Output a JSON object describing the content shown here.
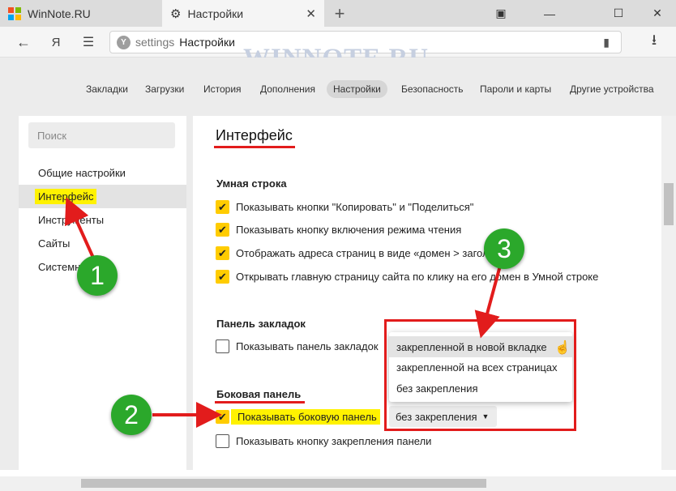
{
  "tabs": [
    {
      "title": "WinNote.RU"
    },
    {
      "title": "Настройки"
    }
  ],
  "address": {
    "host": "settings",
    "title": "Настройки",
    "yandex_button": "Я"
  },
  "watermark": "WINNOTE.RU",
  "nav_menu": [
    "Закладки",
    "Загрузки",
    "История",
    "Дополнения",
    "Настройки",
    "Безопасность",
    "Пароли и карты",
    "Другие устройства"
  ],
  "nav_active": "Настройки",
  "sidebar": {
    "search_placeholder": "Поиск",
    "items": [
      "Общие настройки",
      "Интерфейс",
      "Инструменты",
      "Сайты",
      "Системные"
    ]
  },
  "content": {
    "heading": "Интерфейс",
    "smart_line": {
      "title": "Умная строка",
      "options": [
        {
          "label": "Показывать кнопки \"Копировать\" и \"Поделиться\"",
          "checked": true
        },
        {
          "label": "Показывать кнопку включения режима чтения",
          "checked": true
        },
        {
          "label": "Отображать адреса страниц в виде «домен > заголовок»",
          "checked": true
        },
        {
          "label": "Открывать главную страницу сайта по клику на его домен в Умной строке",
          "checked": true
        }
      ]
    },
    "bookmarks_bar": {
      "title": "Панель закладок",
      "option": {
        "label": "Показывать панель закладок",
        "checked": false
      }
    },
    "side_panel": {
      "title": "Боковая панель",
      "options": [
        {
          "label": "Показывать боковую панель",
          "checked": true
        },
        {
          "label": "Показывать кнопку закрепления панели",
          "checked": false
        }
      ],
      "select_value": "без закрепления",
      "dropdown_options": [
        "закрепленной в новой вкладке",
        "закрепленной на всех страницах",
        "без закрепления"
      ]
    }
  },
  "annotations": [
    "1",
    "2",
    "3"
  ],
  "colors": {
    "accent_red": "#e21c1c",
    "checkbox_yellow": "#ffcc00",
    "highlight_yellow": "#fff200",
    "badge_green": "#2ba82b"
  }
}
